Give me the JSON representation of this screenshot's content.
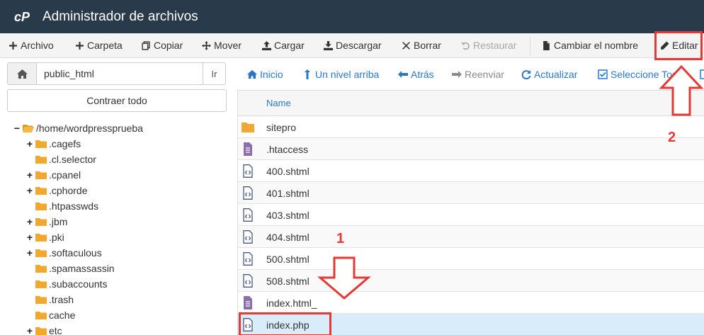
{
  "header": {
    "title": "Administrador de archivos",
    "logo_icon": "cpanel-logo-icon",
    "bg_color": "#293a4a"
  },
  "toolbar": {
    "archivo": "Archivo",
    "carpeta": "Carpeta",
    "copiar": "Copiar",
    "mover": "Mover",
    "cargar": "Cargar",
    "descargar": "Descargar",
    "borrar": "Borrar",
    "restaurar": "Restaurar",
    "cambiar_nombre": "Cambiar el nombre",
    "editar": "Editar"
  },
  "left": {
    "path_value": "public_html",
    "go_label": "Ir",
    "collapse_label": "Contraer todo",
    "tree": {
      "root": "/home/wordpressprueba",
      "items": [
        {
          "label": ".cagefs",
          "expandable": true
        },
        {
          "label": ".cl.selector",
          "expandable": false
        },
        {
          "label": ".cpanel",
          "expandable": true
        },
        {
          "label": ".cphorde",
          "expandable": true
        },
        {
          "label": ".htpasswds",
          "expandable": false
        },
        {
          "label": ".jbm",
          "expandable": true
        },
        {
          "label": ".pki",
          "expandable": true
        },
        {
          "label": ".softaculous",
          "expandable": true
        },
        {
          "label": ".spamassassin",
          "expandable": false
        },
        {
          "label": ".subaccounts",
          "expandable": false
        },
        {
          "label": ".trash",
          "expandable": false
        },
        {
          "label": "cache",
          "expandable": false
        },
        {
          "label": "etc",
          "expandable": true
        }
      ]
    }
  },
  "nav": {
    "inicio": "Inicio",
    "up": "Un nivel arriba",
    "back": "Atrás",
    "forward": "Reenviar",
    "refresh": "Actualizar",
    "select_all": "Seleccione Todo"
  },
  "table": {
    "col_name": "Name",
    "rows": [
      {
        "name": "sitepro",
        "icon": "folder-icon"
      },
      {
        "name": ".htaccess",
        "icon": "text-file-icon"
      },
      {
        "name": "400.shtml",
        "icon": "code-file-icon"
      },
      {
        "name": "401.shtml",
        "icon": "code-file-icon"
      },
      {
        "name": "403.shtml",
        "icon": "code-file-icon"
      },
      {
        "name": "404.shtml",
        "icon": "code-file-icon"
      },
      {
        "name": "500.shtml",
        "icon": "code-file-icon"
      },
      {
        "name": "508.shtml",
        "icon": "code-file-icon"
      },
      {
        "name": "index.html_",
        "icon": "text-file-icon"
      },
      {
        "name": "index.php",
        "icon": "code-file-icon",
        "selected": true
      }
    ]
  },
  "annotations": {
    "step1": "1",
    "step2": "2",
    "color": "#e53935"
  },
  "colors": {
    "link": "#2a77c9",
    "selected_row": "#d9ecfa",
    "folder": "#f0a830"
  }
}
